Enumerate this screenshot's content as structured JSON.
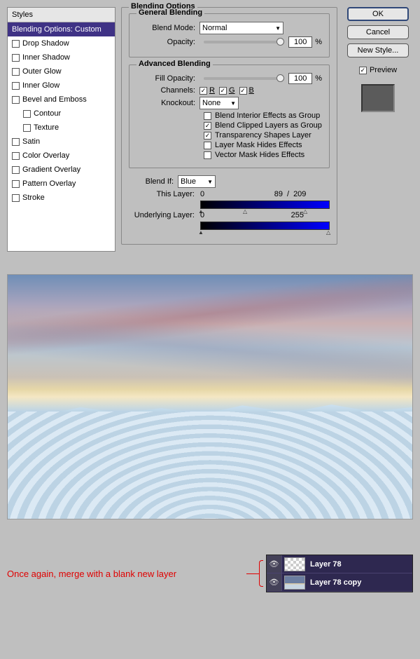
{
  "styles": {
    "header": "Styles",
    "items": [
      {
        "label": "Blending Options: Custom",
        "checked": null,
        "active": true,
        "sub": false
      },
      {
        "label": "Drop Shadow",
        "checked": false,
        "active": false,
        "sub": false
      },
      {
        "label": "Inner Shadow",
        "checked": false,
        "active": false,
        "sub": false
      },
      {
        "label": "Outer Glow",
        "checked": false,
        "active": false,
        "sub": false
      },
      {
        "label": "Inner Glow",
        "checked": false,
        "active": false,
        "sub": false
      },
      {
        "label": "Bevel and Emboss",
        "checked": false,
        "active": false,
        "sub": false
      },
      {
        "label": "Contour",
        "checked": false,
        "active": false,
        "sub": true
      },
      {
        "label": "Texture",
        "checked": false,
        "active": false,
        "sub": true
      },
      {
        "label": "Satin",
        "checked": false,
        "active": false,
        "sub": false
      },
      {
        "label": "Color Overlay",
        "checked": false,
        "active": false,
        "sub": false
      },
      {
        "label": "Gradient Overlay",
        "checked": false,
        "active": false,
        "sub": false
      },
      {
        "label": "Pattern Overlay",
        "checked": false,
        "active": false,
        "sub": false
      },
      {
        "label": "Stroke",
        "checked": false,
        "active": false,
        "sub": false
      }
    ]
  },
  "blending_options": {
    "title": "Blending Options",
    "general": {
      "title": "General Blending",
      "blend_mode_label": "Blend Mode:",
      "blend_mode": "Normal",
      "opacity_label": "Opacity:",
      "opacity": "100",
      "opacity_unit": "%"
    },
    "advanced": {
      "title": "Advanced Blending",
      "fill_opacity_label": "Fill Opacity:",
      "fill_opacity": "100",
      "fill_opacity_unit": "%",
      "channels_label": "Channels:",
      "channels": {
        "R": true,
        "G": true,
        "B": true
      },
      "knockout_label": "Knockout:",
      "knockout": "None",
      "checks": [
        {
          "label": "Blend Interior Effects as Group",
          "checked": false
        },
        {
          "label": "Blend Clipped Layers as Group",
          "checked": true
        },
        {
          "label": "Transparency Shapes Layer",
          "checked": true
        },
        {
          "label": "Layer Mask Hides Effects",
          "checked": false
        },
        {
          "label": "Vector Mask Hides Effects",
          "checked": false
        }
      ]
    },
    "blendif": {
      "label": "Blend If:",
      "channel": "Blue",
      "this_layer_label": "This Layer:",
      "this_layer": {
        "low": "0",
        "high_split": "89",
        "high": "209"
      },
      "underlying_label": "Underlying Layer:",
      "underlying": {
        "low": "0",
        "high": "255"
      }
    }
  },
  "buttons": {
    "ok": "OK",
    "cancel": "Cancel",
    "new_style": "New Style...",
    "preview": "Preview"
  },
  "annotation": "Once again, merge with a blank new layer",
  "layers": [
    {
      "name": "Layer 78",
      "thumb": "checker"
    },
    {
      "name": "Layer 78 copy",
      "thumb": "sky"
    }
  ]
}
